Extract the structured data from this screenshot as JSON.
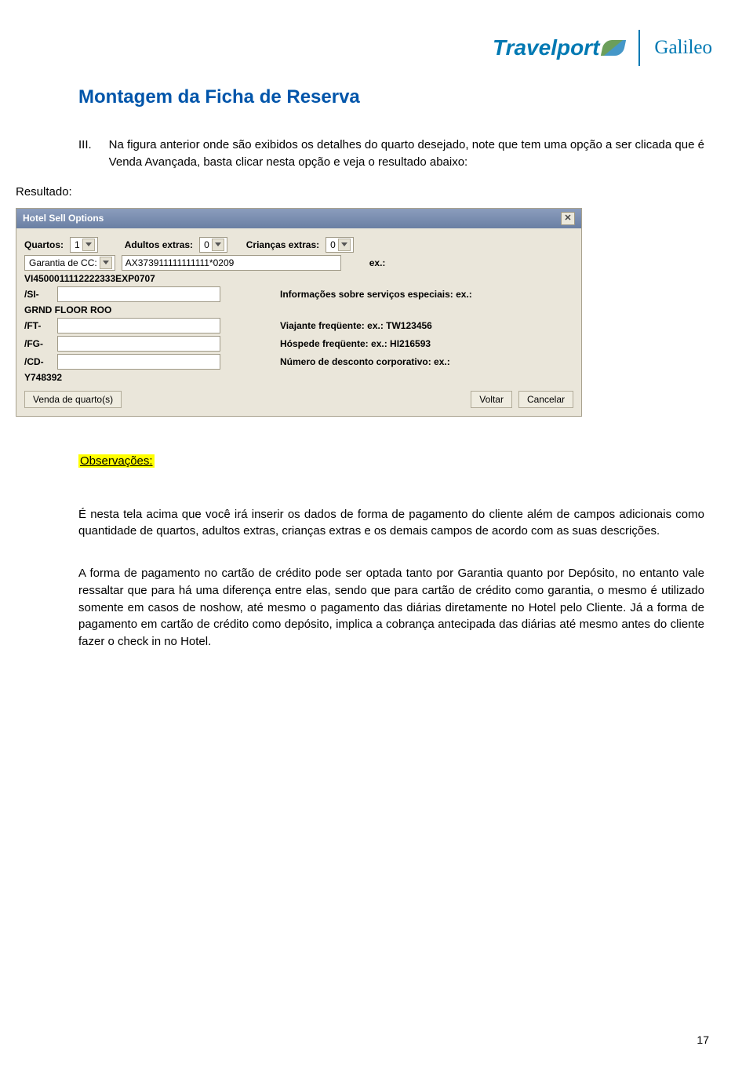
{
  "header": {
    "brand1": "Travelport",
    "brand2": "Galileo"
  },
  "title": "Montagem da Ficha de Reserva",
  "intro": {
    "numeral": "III.",
    "text": "Na figura anterior onde são exibidos os detalhes do quarto desejado, note que tem uma opção a ser clicada que é Venda Avançada, basta clicar nesta opção e veja o resultado abaixo:"
  },
  "resultado_label": "Resultado:",
  "dialog": {
    "title": "Hotel Sell Options",
    "close": "✕",
    "quartos_label": "Quartos:",
    "quartos_value": "1",
    "adultos_label": "Adultos extras:",
    "adultos_value": "0",
    "criancas_label": "Crianças extras:",
    "criancas_value": "0",
    "garantia_label": "Garantia de CC:",
    "cc_value": "AX373911111111111*0209",
    "ex_label": "ex.:",
    "vi_example": "VI4500011112222333EXP0707",
    "si_label": "/SI-",
    "si_hint": "Informações sobre serviços especiais: ex.:",
    "si_example": "GRND FLOOR ROO",
    "ft_label": "/FT-",
    "ft_hint": "Viajante freqüente: ex.: TW123456",
    "fg_label": "/FG-",
    "fg_hint": "Hóspede freqüente: ex.: HI216593",
    "cd_label": "/CD-",
    "cd_hint": "Número de desconto corporativo: ex.:",
    "cd_example": "Y748392",
    "btn_sell": "Venda de quarto(s)",
    "btn_back": "Voltar",
    "btn_cancel": "Cancelar"
  },
  "obs_label": "Observações:",
  "para1": "É nesta tela acima que você irá inserir os dados de forma de pagamento do cliente além de campos adicionais como quantidade de quartos, adultos extras, crianças extras e os demais campos de acordo com as suas descrições.",
  "para2": "A forma de pagamento no cartão de crédito pode ser optada tanto por Garantia quanto por Depósito, no entanto vale ressaltar que para há uma diferença entre elas, sendo que para cartão de crédito como garantia, o mesmo é utilizado somente em casos de noshow, até mesmo o pagamento das diárias diretamente no Hotel pelo Cliente. Já a forma de pagamento em cartão de crédito como depósito, implica a cobrança antecipada das diárias até mesmo antes do cliente fazer o check in no Hotel.",
  "page_number": "17"
}
